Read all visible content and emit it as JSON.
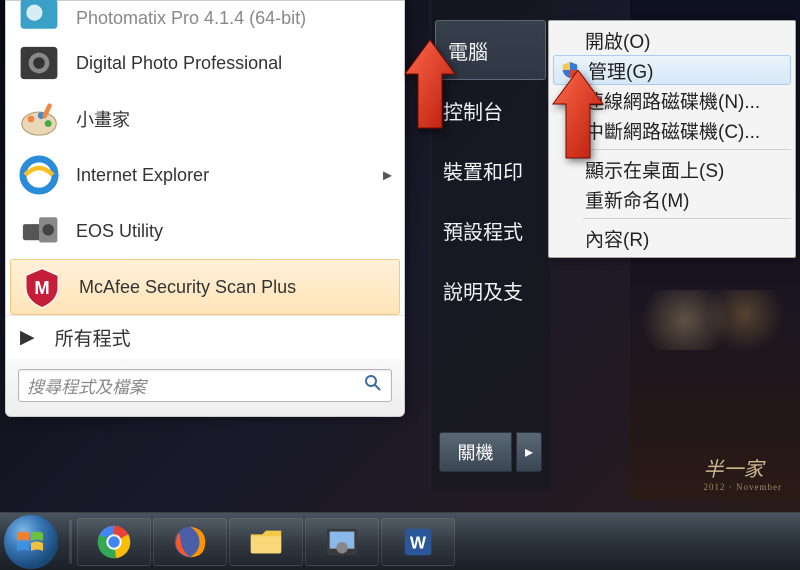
{
  "programs": [
    {
      "label": "Photomatix Pro 4.1.4 (64-bit)",
      "icon": "photomatix"
    },
    {
      "label": "Digital Photo Professional",
      "icon": "dpp"
    },
    {
      "label": "小畫家",
      "icon": "mspaint"
    },
    {
      "label": "Internet Explorer",
      "icon": "ie",
      "has_submenu": true
    },
    {
      "label": "EOS Utility",
      "icon": "eos"
    },
    {
      "label": "McAfee Security Scan Plus",
      "icon": "mcafee",
      "highlighted": true
    }
  ],
  "all_programs_label": "所有程式",
  "search_placeholder": "搜尋程式及檔案",
  "right_panel": {
    "items": [
      "電腦",
      "控制台",
      "裝置和印",
      "預設程式",
      "說明及支"
    ],
    "selected_index": 0
  },
  "shutdown": {
    "label": "關機"
  },
  "context_menu": {
    "items": [
      {
        "label": "開啟(O)"
      },
      {
        "label": "管理(G)",
        "icon": "shield",
        "hover": true
      },
      {
        "label": "連線網路磁碟機(N)..."
      },
      {
        "label": "中斷網路磁碟機(C)..."
      },
      {
        "separator_before": true,
        "label": "顯示在桌面上(S)"
      },
      {
        "label": "重新命名(M)"
      },
      {
        "separator_before": true,
        "label": "內容(R)"
      }
    ]
  },
  "taskbar": {
    "items": [
      "start",
      "divider",
      "chrome",
      "firefox",
      "explorer",
      "dpp",
      "word"
    ]
  },
  "watermark": {
    "text": "半一家",
    "sub": "2012 · November"
  }
}
